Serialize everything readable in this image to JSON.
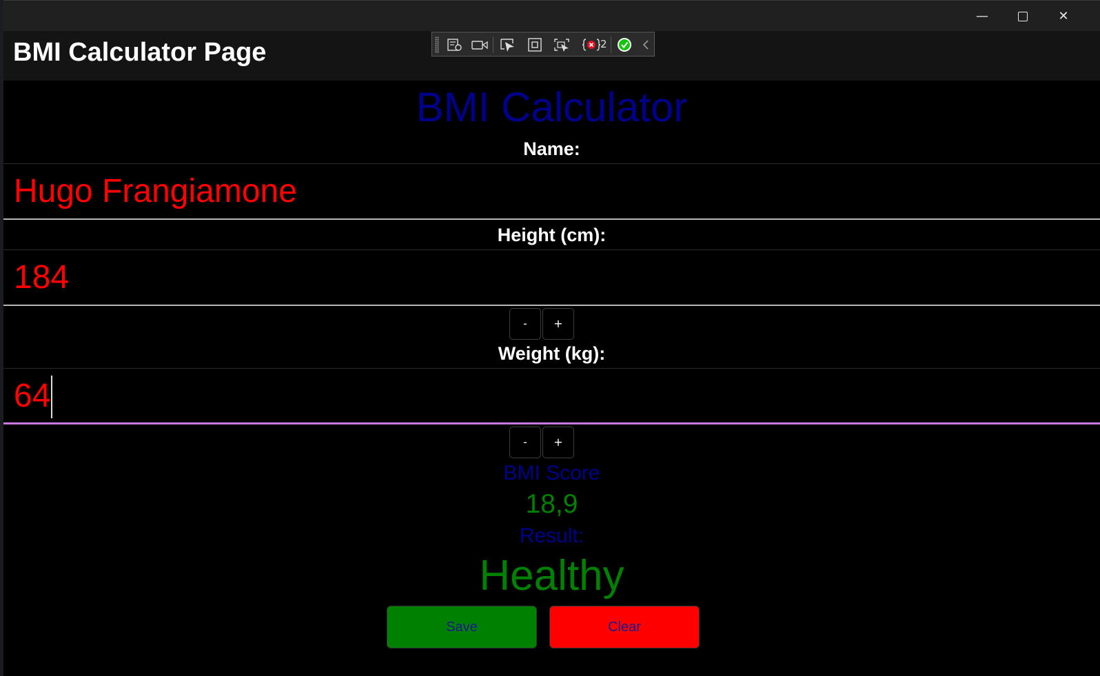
{
  "window": {
    "minimize_glyph": "—",
    "close_glyph": "✕",
    "controls": [
      "minimize-icon",
      "maximize-icon",
      "close-icon"
    ]
  },
  "navbar": {
    "title": "BMI Calculator Page"
  },
  "debug_toolbar": {
    "icons": [
      "live-visual-tree-icon",
      "record-icon",
      "select-element-icon",
      "display-layout-adorners-icon",
      "track-focus-icon",
      "binding-failures-icon",
      "hot-reload-ok-icon",
      "collapse-chevron-icon"
    ],
    "binding_failures_count": "2",
    "colors": {
      "error": "#e81123",
      "ok": "#16c60c"
    }
  },
  "form": {
    "heading": "BMI Calculator",
    "name_label": "Name:",
    "name_value": "Hugo Frangiamone",
    "height_label": "Height (cm):",
    "height_value": "184",
    "weight_label": "Weight (kg):",
    "weight_value": "64",
    "decrement_label": "-",
    "increment_label": "+",
    "score_label": "BMI Score",
    "score_value": "18,9",
    "result_label": "Result:",
    "result_value": "Healthy",
    "save_label": "Save",
    "clear_label": "Clear"
  },
  "colors": {
    "heading": "#00008b",
    "entry_text": "#ff0000",
    "result_text": "#008000",
    "save_bg": "#008000",
    "clear_bg": "#ff0000",
    "focus_underline": "#c878e0"
  }
}
